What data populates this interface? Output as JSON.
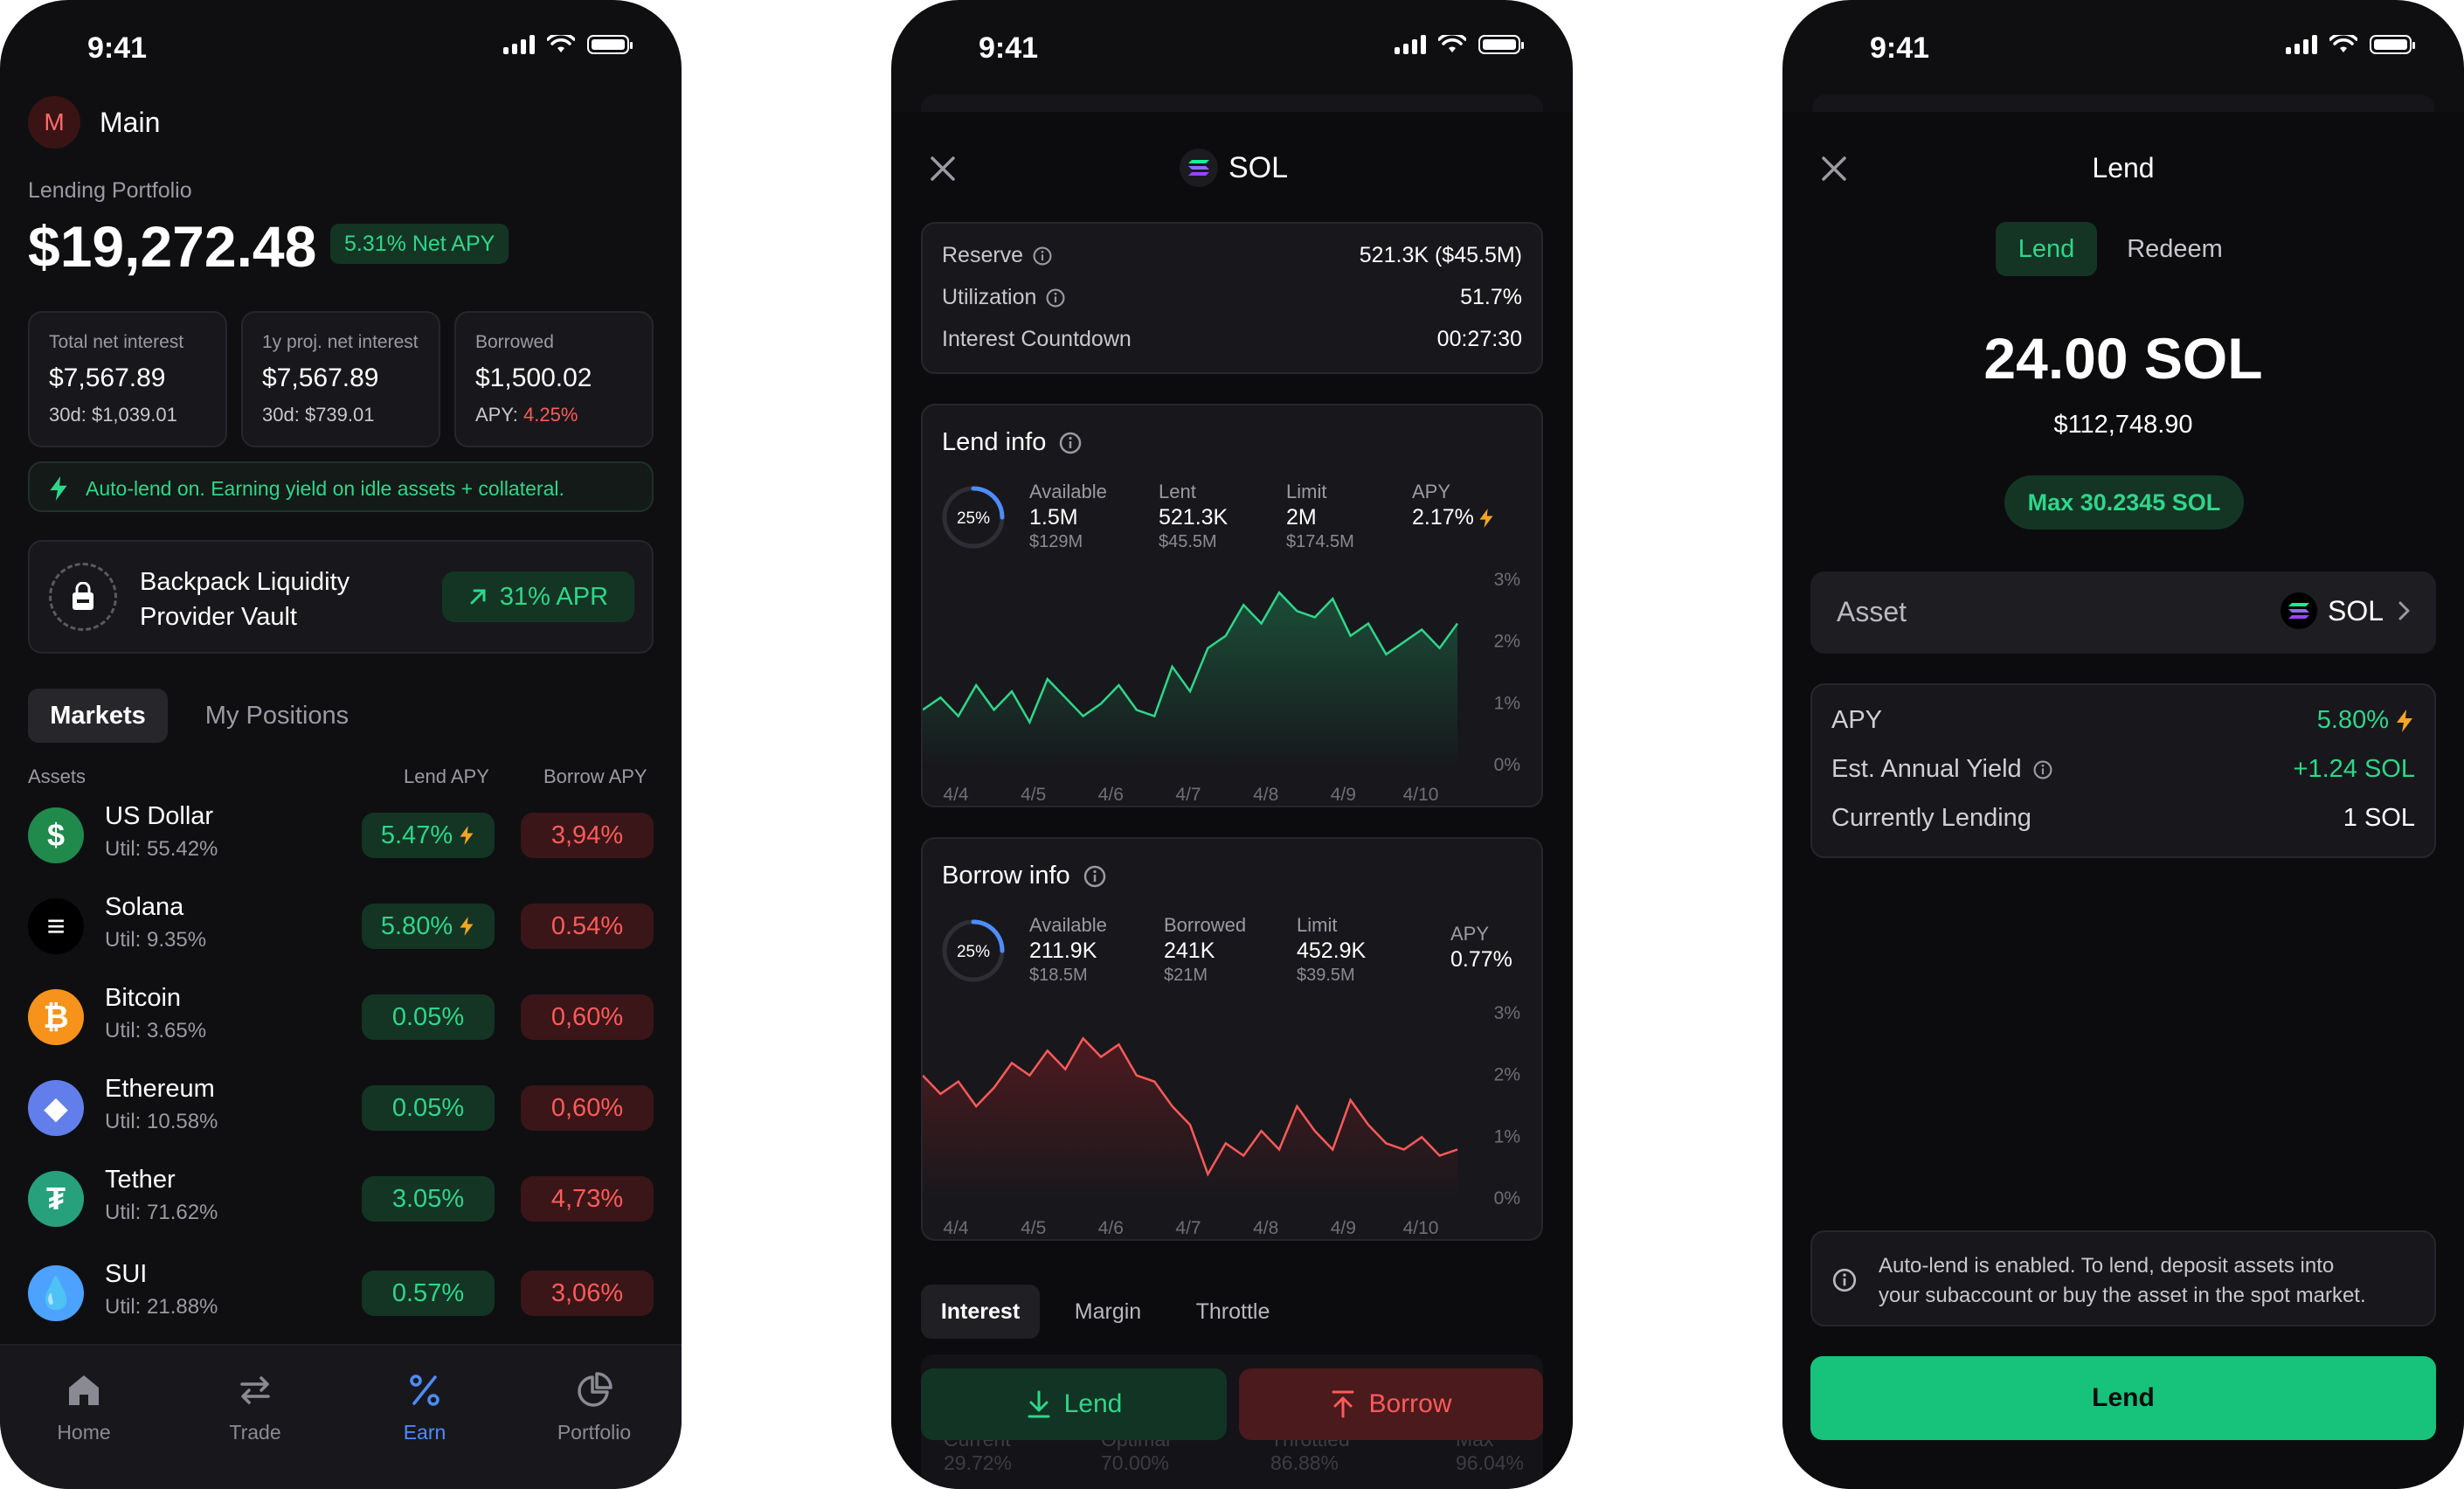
{
  "status": {
    "time": "9:41"
  },
  "screen1": {
    "account": {
      "initial": "M",
      "name": "Main"
    },
    "portfolio_label": "Lending Portfolio",
    "portfolio_value": "$19,272.48",
    "net_apy": "5.31% Net APY",
    "stats": [
      {
        "label": "Total net interest",
        "value": "$7,567.89",
        "sub_label": "30d:",
        "sub_value": "$1,039.01"
      },
      {
        "label": "1y proj. net interest",
        "value": "$7,567.89",
        "sub_label": "30d:",
        "sub_value": "$739.01"
      },
      {
        "label": "Borrowed",
        "value": "$1,500.02",
        "sub_label": "APY:",
        "sub_value": "4.25%"
      }
    ],
    "autolend_banner": "Auto-lend on. Earning yield on idle assets + collateral.",
    "vault": {
      "name_line1": "Backpack Liquidity",
      "name_line2": "Provider Vault",
      "apr": "31% APR"
    },
    "tabs": [
      "Markets",
      "My Positions"
    ],
    "table_headers": {
      "assets": "Assets",
      "lend": "Lend APY",
      "borrow": "Borrow APY"
    },
    "assets": [
      {
        "name": "US Dollar",
        "util": "Util: 55.42%",
        "lend": "5.47%",
        "borrow": "3,94%",
        "boost": true,
        "symbol": "$",
        "color": "#1f8a4c"
      },
      {
        "name": "Solana",
        "util": "Util: 9.35%",
        "lend": "5.80%",
        "borrow": "0.54%",
        "boost": true,
        "symbol": "≡",
        "color": "#000000"
      },
      {
        "name": "Bitcoin",
        "util": "Util: 3.65%",
        "lend": "0.05%",
        "borrow": "0,60%",
        "boost": false,
        "symbol": "₿",
        "color": "#f7931a"
      },
      {
        "name": "Ethereum",
        "util": "Util: 10.58%",
        "lend": "0.05%",
        "borrow": "0,60%",
        "boost": false,
        "symbol": "◆",
        "color": "#627eea"
      },
      {
        "name": "Tether",
        "util": "Util: 71.62%",
        "lend": "3.05%",
        "borrow": "4,73%",
        "boost": false,
        "symbol": "₮",
        "color": "#26a17b"
      },
      {
        "name": "SUI",
        "util": "Util: 21.88%",
        "lend": "0.57%",
        "borrow": "3,06%",
        "boost": false,
        "symbol": "💧",
        "color": "#4da2ff"
      }
    ],
    "nav": [
      {
        "label": "Home",
        "icon": "home-icon"
      },
      {
        "label": "Trade",
        "icon": "trade-icon"
      },
      {
        "label": "Earn",
        "icon": "percent-icon"
      },
      {
        "label": "Portfolio",
        "icon": "pie-chart-icon"
      }
    ],
    "active_nav": "Earn"
  },
  "screen2": {
    "title": "SOL",
    "reserve": [
      {
        "label": "Reserve",
        "value": "521.3K ($45.5M)",
        "info": true
      },
      {
        "label": "Utilization",
        "value": "51.7%",
        "info": true
      },
      {
        "label": "Interest Countdown",
        "value": "00:27:30",
        "info": false
      }
    ],
    "lend_info": {
      "title": "Lend info",
      "ring": "25%",
      "ring_fraction": 0.25,
      "stats": [
        {
          "label": "Available",
          "value": "1.5M",
          "sub": "$129M"
        },
        {
          "label": "Lent",
          "value": "521.3K",
          "sub": "$45.5M"
        },
        {
          "label": "Limit",
          "value": "2M",
          "sub": "$174.5M"
        }
      ],
      "apy_label": "APY",
      "apy_value": "2.17%"
    },
    "borrow_info": {
      "title": "Borrow info",
      "ring": "25%",
      "ring_fraction": 0.25,
      "stats": [
        {
          "label": "Available",
          "value": "211.9K",
          "sub": "$18.5M"
        },
        {
          "label": "Borrowed",
          "value": "241K",
          "sub": "$21M"
        },
        {
          "label": "Limit",
          "value": "452.9K",
          "sub": "$39.5M"
        }
      ],
      "apy_label": "APY",
      "apy_value": "0.77%"
    },
    "chart_data": [
      {
        "type": "area",
        "x": [
          "4/4",
          "4/5",
          "4/6",
          "4/7",
          "4/8",
          "4/9",
          "4/10"
        ],
        "yticks": [
          "3%",
          "2%",
          "1%",
          "0%"
        ],
        "ylim": [
          0,
          3
        ],
        "series": [
          {
            "values": [
              0.9,
              1.1,
              0.8,
              1.3,
              0.9,
              1.2,
              0.7,
              1.4,
              1.1,
              0.8,
              1.0,
              1.3,
              0.9,
              0.8,
              1.6,
              1.2,
              1.9,
              2.1,
              2.6,
              2.3,
              2.8,
              2.5,
              2.4,
              2.7,
              2.1,
              2.3,
              1.8,
              2.0,
              2.2,
              1.9,
              2.3
            ]
          }
        ]
      },
      {
        "type": "area",
        "x": [
          "4/4",
          "4/5",
          "4/6",
          "4/7",
          "4/8",
          "4/9",
          "4/10"
        ],
        "yticks": [
          "3%",
          "2%",
          "1%",
          "0%"
        ],
        "ylim": [
          0,
          3
        ],
        "series": [
          {
            "values": [
              2.0,
              1.7,
              1.9,
              1.5,
              1.8,
              2.2,
              2.0,
              2.4,
              2.1,
              2.6,
              2.3,
              2.5,
              2.0,
              1.9,
              1.5,
              1.2,
              0.4,
              0.9,
              0.7,
              1.1,
              0.8,
              1.5,
              1.1,
              0.8,
              1.6,
              1.2,
              0.9,
              0.8,
              1.0,
              0.7,
              0.8
            ]
          }
        ]
      }
    ],
    "bottom_tabs": [
      "Interest",
      "Margin",
      "Throttle"
    ],
    "hidden_stats": [
      {
        "label": "Current",
        "value": "29.72%"
      },
      {
        "label": "Optimal",
        "value": "70.00%"
      },
      {
        "label": "Throttled",
        "value": "86.88%"
      },
      {
        "label": "Max",
        "value": "96.04%"
      }
    ],
    "lend_button": "Lend",
    "borrow_button": "Borrow"
  },
  "screen3": {
    "title": "Lend",
    "tabs": [
      "Lend",
      "Redeem"
    ],
    "amount": "24.00 SOL",
    "amount_usd": "$112,748.90",
    "max": "Max 30.2345 SOL",
    "asset_label": "Asset",
    "asset_value": "SOL",
    "details": [
      {
        "label": "APY",
        "value": "5.80%",
        "info": false
      },
      {
        "label": "Est. Annual Yield",
        "value": "+1.24 SOL",
        "info": true
      },
      {
        "label": "Currently Lending",
        "value": "1 SOL",
        "info": false
      }
    ],
    "notice": "Auto-lend is enabled. To lend, deposit assets into your subaccount or buy the asset in the spot market.",
    "notice_line1": "Auto-lend is enabled. To lend, deposit assets into",
    "notice_line2": "your subaccount or buy the asset in the spot market.",
    "lend_button": "Lend"
  },
  "colors": {
    "green": "#2fd68a",
    "red": "#ff5a5a",
    "accent_blue": "#4e8cff",
    "bg": "#0f0f12",
    "card": "#18181c"
  }
}
